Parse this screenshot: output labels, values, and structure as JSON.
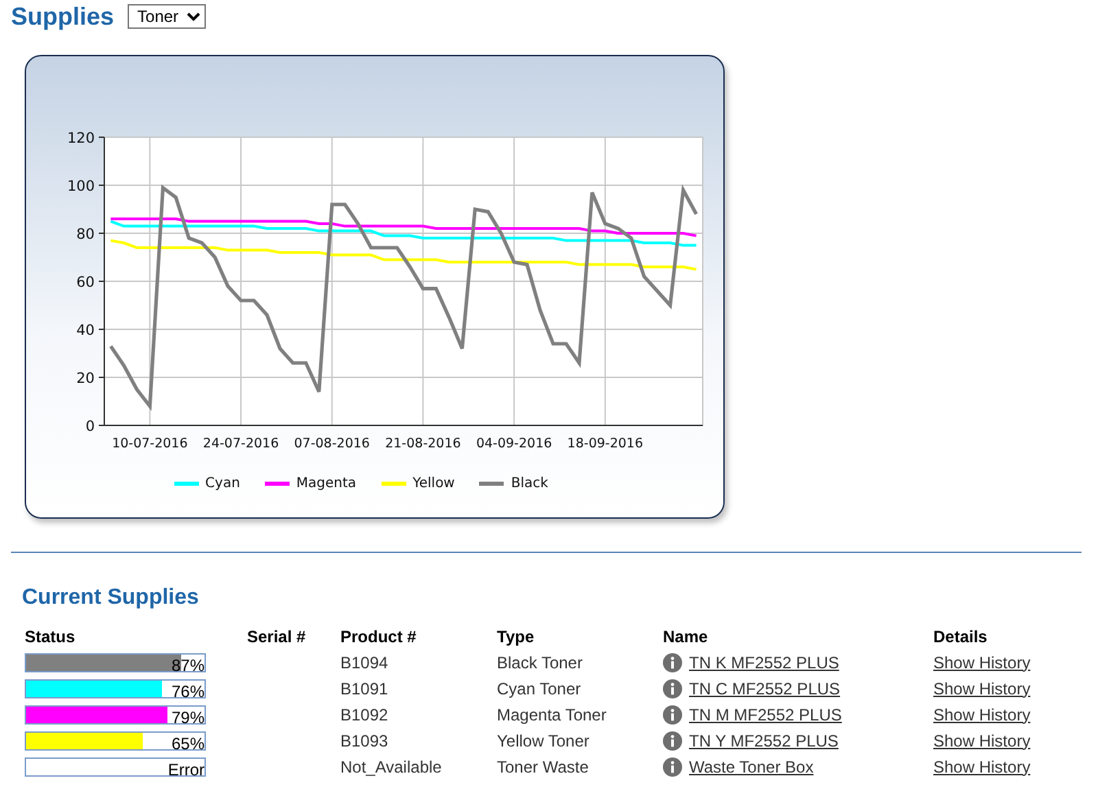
{
  "header": {
    "title": "Supplies",
    "dropdown": {
      "value": "Toner"
    }
  },
  "chart": {
    "chart_data": {
      "type": "line",
      "categories": [
        null,
        null,
        null,
        "10-07-2016",
        null,
        null,
        null,
        null,
        null,
        null,
        "24-07-2016",
        null,
        null,
        null,
        null,
        null,
        null,
        "07-08-2016",
        null,
        null,
        null,
        null,
        null,
        null,
        "21-08-2016",
        null,
        null,
        null,
        null,
        null,
        null,
        "04-09-2016",
        null,
        null,
        null,
        null,
        null,
        null,
        "18-09-2016",
        null,
        null,
        null,
        null,
        null,
        null,
        null
      ],
      "ylim": [
        0,
        120
      ],
      "grid": true,
      "yticks": [
        0,
        20,
        40,
        60,
        80,
        100,
        120
      ],
      "series": [
        {
          "name": "Cyan",
          "color": "#00ffff",
          "values": [
            85,
            83,
            83,
            83,
            83,
            83,
            83,
            83,
            83,
            83,
            83,
            83,
            82,
            82,
            82,
            82,
            81,
            81,
            81,
            81,
            81,
            79,
            79,
            79,
            78,
            78,
            78,
            78,
            78,
            78,
            78,
            78,
            78,
            78,
            78,
            77,
            77,
            77,
            77,
            77,
            77,
            76,
            76,
            76,
            75,
            75
          ]
        },
        {
          "name": "Magenta",
          "color": "#ff00ff",
          "values": [
            86,
            86,
            86,
            86,
            86,
            86,
            85,
            85,
            85,
            85,
            85,
            85,
            85,
            85,
            85,
            85,
            84,
            84,
            83,
            83,
            83,
            83,
            83,
            83,
            83,
            82,
            82,
            82,
            82,
            82,
            82,
            82,
            82,
            82,
            82,
            82,
            82,
            81,
            81,
            80,
            80,
            80,
            80,
            80,
            80,
            79
          ]
        },
        {
          "name": "Yellow",
          "color": "#ffff00",
          "values": [
            77,
            76,
            74,
            74,
            74,
            74,
            74,
            74,
            74,
            73,
            73,
            73,
            73,
            72,
            72,
            72,
            72,
            71,
            71,
            71,
            71,
            69,
            69,
            69,
            69,
            69,
            68,
            68,
            68,
            68,
            68,
            68,
            68,
            68,
            68,
            68,
            67,
            67,
            67,
            67,
            67,
            66,
            66,
            66,
            66,
            65
          ]
        },
        {
          "name": "Black",
          "color": "#808080",
          "values": [
            33,
            25,
            15,
            8,
            99,
            95,
            78,
            76,
            70,
            58,
            52,
            52,
            46,
            32,
            26,
            26,
            14,
            92,
            92,
            84,
            74,
            74,
            74,
            66,
            57,
            57,
            45,
            32,
            90,
            89,
            80,
            68,
            67,
            48,
            34,
            34,
            26,
            97,
            84,
            82,
            78,
            62,
            56,
            50,
            98,
            88
          ]
        }
      ]
    }
  },
  "current_supplies": {
    "title": "Current Supplies",
    "columns": [
      "Status",
      "Serial #",
      "Product #",
      "Type",
      "Name",
      "Details"
    ],
    "rows": [
      {
        "status": {
          "level": 0.87,
          "reading": "87%",
          "color": "#808080"
        },
        "product": "B1094",
        "type": "Black Toner",
        "name": "TN K MF2552 PLUS",
        "details": "Show History"
      },
      {
        "status": {
          "level": 0.76,
          "reading": "76%",
          "color": "#00ffff"
        },
        "product": "B1091",
        "type": "Cyan Toner",
        "name": "TN C MF2552 PLUS",
        "details": "Show History"
      },
      {
        "status": {
          "level": 0.79,
          "reading": "79%",
          "color": "#ff00ff"
        },
        "product": "B1092",
        "type": "Magenta Toner",
        "name": "TN M MF2552 PLUS",
        "details": "Show History"
      },
      {
        "status": {
          "level": 0.65,
          "reading": "65%",
          "color": "#ffff00"
        },
        "product": "B1093",
        "type": "Yellow Toner",
        "name": "TN Y MF2552 PLUS",
        "details": "Show History"
      },
      {
        "status": {
          "reading": "Error"
        },
        "product": "Not_Available",
        "type": "Toner Waste",
        "name": "Waste Toner Box",
        "details": "Show History"
      }
    ]
  }
}
